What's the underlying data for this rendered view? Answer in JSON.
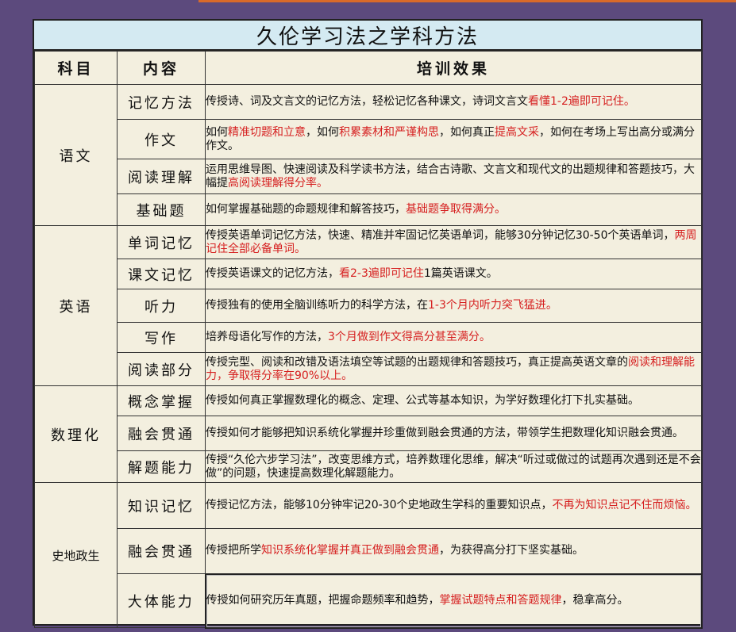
{
  "title": "久伦学习法之学科方法",
  "headers": {
    "subject": "科目",
    "content": "内容",
    "effect": "培训效果"
  },
  "colors": {
    "background": "#5c4a7d",
    "sheet": "#f3efdf",
    "title_bar": "#d4eaf2",
    "highlight": "#d62020"
  },
  "groups": [
    {
      "subject": "语文",
      "rows": [
        {
          "topic": "记忆方法",
          "segments": [
            {
              "t": "传授诗、词及文言文的记忆方法，轻松记忆各种课文，诗词文言文",
              "r": false
            },
            {
              "t": "看懂1-2遍即可记住。",
              "r": true
            }
          ]
        },
        {
          "topic": "作文",
          "segments": [
            {
              "t": "如何",
              "r": false
            },
            {
              "t": "精准切题和立意",
              "r": true
            },
            {
              "t": "，如何",
              "r": false
            },
            {
              "t": "积累素材和严谨构思",
              "r": true
            },
            {
              "t": "，如何真正",
              "r": false
            },
            {
              "t": "提高文采",
              "r": true
            },
            {
              "t": "，如何在考场上写出高分或满分作文。",
              "r": false
            }
          ]
        },
        {
          "topic": "阅读理解",
          "segments": [
            {
              "t": "运用思维导图、快速阅读及科学读书方法，结合古诗歌、文言文和现代文的出题规律和答题技巧，大幅提",
              "r": false
            },
            {
              "t": "高阅读理解得分率。",
              "r": true
            }
          ]
        },
        {
          "topic": "基础题",
          "segments": [
            {
              "t": "如何掌握基础题的命题规律和解答技巧，",
              "r": false
            },
            {
              "t": "基础题争取得满分。",
              "r": true
            }
          ]
        }
      ]
    },
    {
      "subject": "英语",
      "rows": [
        {
          "topic": "单词记忆",
          "segments": [
            {
              "t": "传授英语单词记忆方法，快速、精准并牢固记忆英语单词，能够30分钟记忆30-50个英语单词，",
              "r": false
            },
            {
              "t": "两周记住全部必备单词。",
              "r": true
            }
          ]
        },
        {
          "topic": "课文记忆",
          "segments": [
            {
              "t": "传授英语课文的记忆方法，",
              "r": false
            },
            {
              "t": "看2-3遍即可记住",
              "r": true
            },
            {
              "t": "1篇英语课文。",
              "r": false
            }
          ]
        },
        {
          "topic": "听力",
          "segments": [
            {
              "t": "传授独有的使用全脑训练听力的科学方法，在",
              "r": false
            },
            {
              "t": "1-3个月内听力突飞猛进。",
              "r": true
            }
          ]
        },
        {
          "topic": "写作",
          "segments": [
            {
              "t": "培养母语化写作的方法，",
              "r": false
            },
            {
              "t": "3个月做到作文得高分甚至满分。",
              "r": true
            }
          ]
        },
        {
          "topic": "阅读部分",
          "segments": [
            {
              "t": "传授完型、阅读和改错及语法填空等试题的出题规律和答题技巧，真正提高英语文章的",
              "r": false
            },
            {
              "t": "阅读和理解能力，争取得分率在90%以上。",
              "r": true
            }
          ]
        }
      ]
    },
    {
      "subject": "数理化",
      "rows": [
        {
          "topic": "概念掌握",
          "segments": [
            {
              "t": "传授如何真正掌握数理化的概念、定理、公式等基本知识，为学好数理化打下扎实基础。",
              "r": false
            }
          ]
        },
        {
          "topic": "融会贯通",
          "segments": [
            {
              "t": "传授如何才能够把知识系统化掌握并珍重做到融会贯通的方法，带领学生把数理化知识融会贯通。",
              "r": false
            }
          ]
        },
        {
          "topic": "解题能力",
          "segments": [
            {
              "t": "传授“久伦六步学习法”，改变思维方式，培养数理化思维，解决“听过或做过的试题再次遇到还是不会做”的问题，快速提高数理化解题能力。",
              "r": false
            }
          ]
        }
      ]
    },
    {
      "subject": "史地政生",
      "rows": [
        {
          "topic": "知识记忆",
          "segments": [
            {
              "t": "传授记忆方法，能够10分钟牢记20-30个史地政生学科的重要知识点，",
              "r": false
            },
            {
              "t": "不再为知识点记不住而烦恼。",
              "r": true
            }
          ]
        },
        {
          "topic": "融会贯通",
          "segments": [
            {
              "t": "传授把所学",
              "r": false
            },
            {
              "t": "知识系统化掌握并真正做到融会贯通",
              "r": true
            },
            {
              "t": "，为获得高分打下坚实基础。",
              "r": false
            }
          ]
        },
        {
          "topic": "大体能力",
          "segments": [
            {
              "t": "传授如何研究历年真题，把握命题频率和趋势，",
              "r": false
            },
            {
              "t": "掌握试题特点和答题规律",
              "r": true
            },
            {
              "t": "，稳拿高分。",
              "r": false
            }
          ]
        }
      ]
    }
  ]
}
